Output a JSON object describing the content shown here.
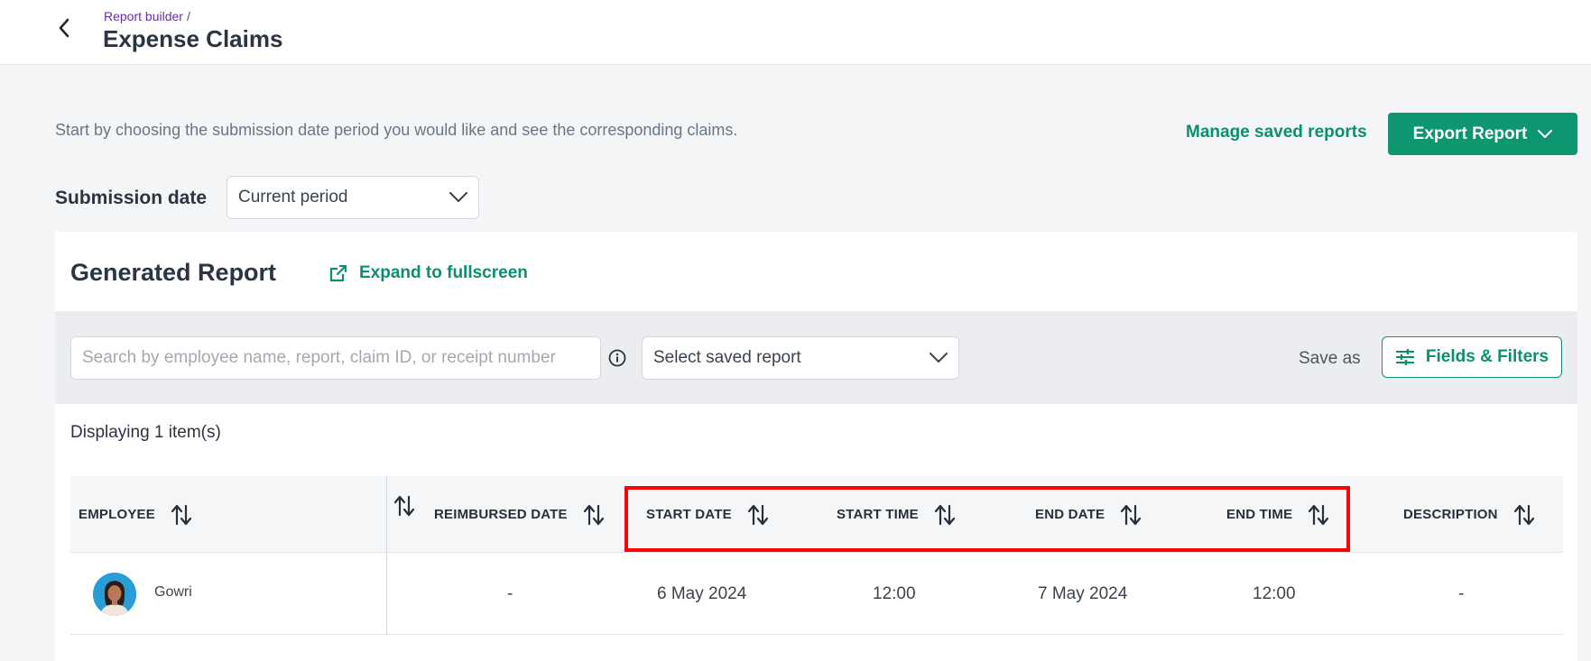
{
  "header": {
    "breadcrumb": "Report builder",
    "breadcrumb_sep": "/",
    "title": "Expense Claims"
  },
  "intro_text": "Start by choosing the submission date period you would like and see the corresponding claims.",
  "actions": {
    "manage_saved": "Manage saved reports",
    "export_label": "Export Report"
  },
  "submission": {
    "label": "Submission date",
    "selected": "Current period"
  },
  "report": {
    "title": "Generated Report",
    "expand_label": "Expand to fullscreen",
    "search_placeholder": "Search by employee name, report, claim ID, or receipt number",
    "saved_report_placeholder": "Select saved report",
    "save_as": "Save as",
    "fields_filters": "Fields & Filters",
    "displaying": "Displaying 1 item(s)"
  },
  "table": {
    "columns": [
      "EMPLOYEE",
      "REIMBURSED DATE",
      "START DATE",
      "START TIME",
      "END DATE",
      "END TIME",
      "DESCRIPTION"
    ],
    "rows": [
      {
        "employee": "Gowri",
        "reimbursed_date": "-",
        "start_date": "6 May 2024",
        "start_time": "12:00",
        "end_date": "7 May 2024",
        "end_time": "12:00",
        "description": "-"
      }
    ]
  },
  "colors": {
    "accent": "#0d9670",
    "highlight": "#ff0000",
    "breadcrumb": "#6a2ea0"
  }
}
